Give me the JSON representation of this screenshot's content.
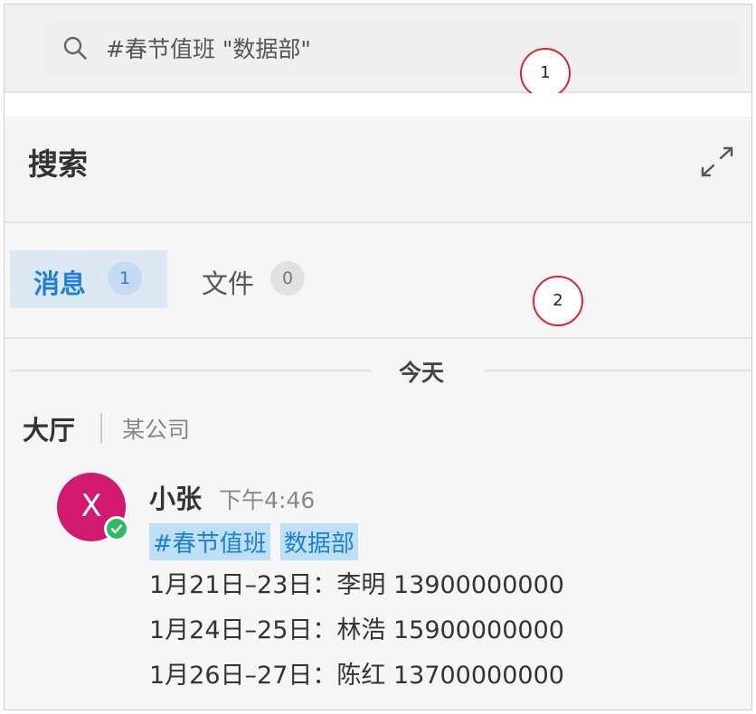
{
  "search": {
    "query": "#春节值班 \"数据部\"",
    "marker": "1"
  },
  "panel": {
    "title": "搜索",
    "marker": "2"
  },
  "tabs": [
    {
      "label": "消息",
      "count": "1"
    },
    {
      "label": "文件",
      "count": "0"
    }
  ],
  "day_divider": "今天",
  "channel": {
    "name": "大厅",
    "org": "某公司"
  },
  "message": {
    "avatar_letter": "X",
    "sender": "小张",
    "time": "下午4:46",
    "tags": [
      "#春节值班",
      "数据部"
    ],
    "lines": [
      "1月21日–23日：李明  13900000000",
      "1月24日–25日：林浩  15900000000",
      "1月26日–27日：陈红  13700000000"
    ]
  },
  "colors": {
    "accent": "#1e7fd9",
    "avatar": "#d1196f",
    "online": "#2ebc62",
    "marker_ring": "#d9262c"
  }
}
